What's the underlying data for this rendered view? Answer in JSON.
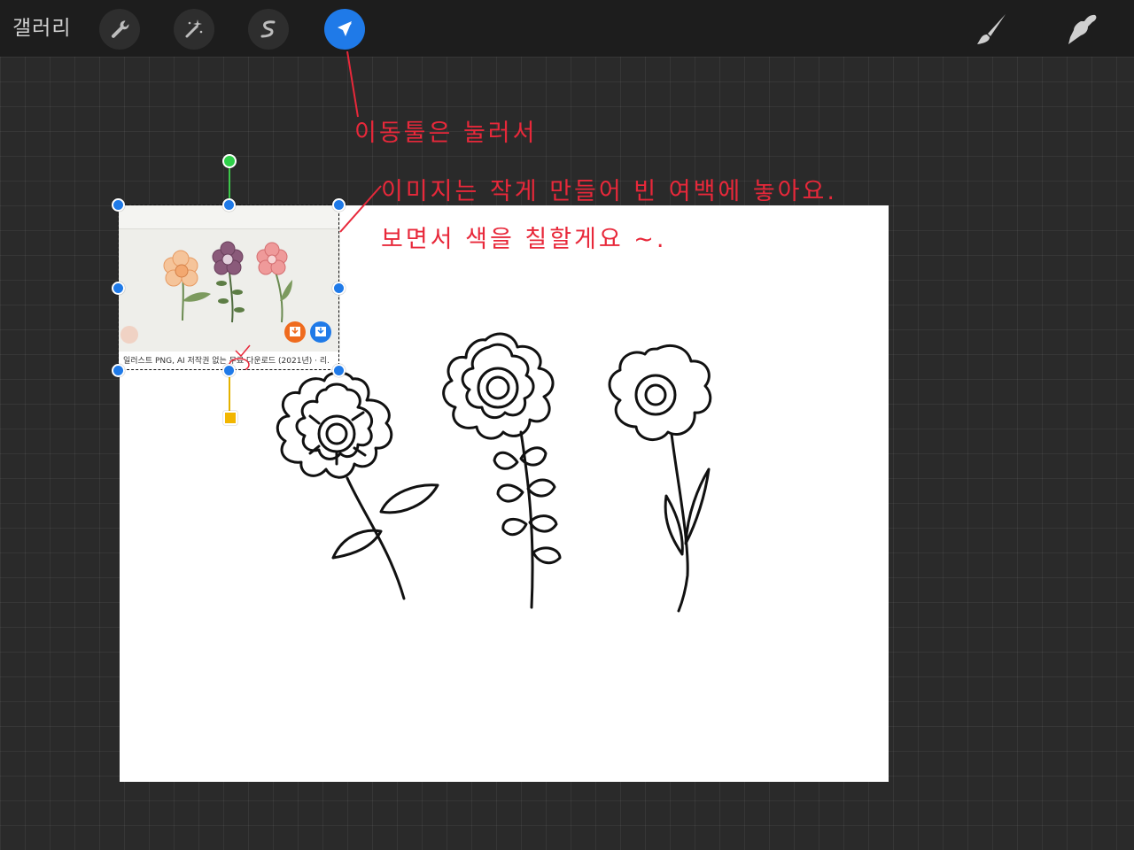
{
  "toolbar": {
    "gallery_label": "갤러리",
    "left_tools": [
      {
        "icon": "wrench-icon",
        "name": "actions"
      },
      {
        "icon": "magic-wand-icon",
        "name": "adjustments"
      },
      {
        "icon": "selection-icon",
        "name": "selection"
      },
      {
        "icon": "arrow-cursor-icon",
        "name": "transform",
        "active": true
      }
    ],
    "right_tools": [
      {
        "icon": "brush-icon",
        "name": "brush"
      },
      {
        "icon": "smudge-icon",
        "name": "smudge"
      }
    ],
    "active_color": "#1f7ae8"
  },
  "reference_image": {
    "caption": "일러스트 PNG, AI 저작권 없는 무료 다운로드 (2021년) · 리."
  },
  "annotations": {
    "line1": "이동툴은 눌러서",
    "line2": "이미지는 작게 만들어 빈 여백에 놓아요.",
    "line3": "보면서 색을 칠할게요 ~."
  },
  "colors": {
    "annotation": "#e8283a",
    "selection_handle": "#1f7ae8",
    "rotate_handle": "#2fcf4a",
    "warp_handle": "#f2b600",
    "background": "#2a2a2a",
    "toolbar": "#1d1d1d"
  }
}
